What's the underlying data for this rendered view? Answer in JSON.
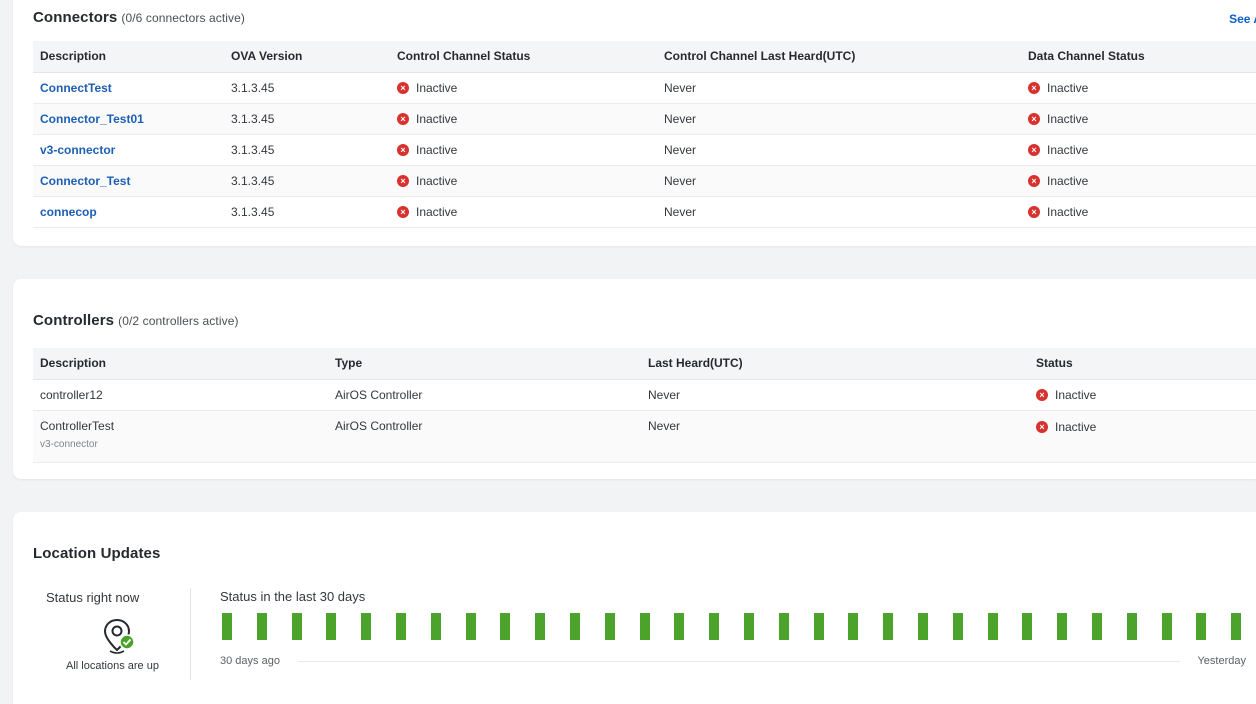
{
  "connectors": {
    "title": "Connectors",
    "subtitle": "(0/6 connectors active)",
    "see_all": "See A",
    "headers": [
      "Description",
      "OVA Version",
      "Control Channel Status",
      "Control Channel Last Heard(UTC)",
      "Data Channel Status"
    ],
    "rows": [
      {
        "description": "ConnectTest",
        "ova": "3.1.3.45",
        "control_status": "Inactive",
        "last_heard": "Never",
        "data_status": "Inactive"
      },
      {
        "description": "Connector_Test01",
        "ova": "3.1.3.45",
        "control_status": "Inactive",
        "last_heard": "Never",
        "data_status": "Inactive"
      },
      {
        "description": "v3-connector",
        "ova": "3.1.3.45",
        "control_status": "Inactive",
        "last_heard": "Never",
        "data_status": "Inactive"
      },
      {
        "description": "Connector_Test",
        "ova": "3.1.3.45",
        "control_status": "Inactive",
        "last_heard": "Never",
        "data_status": "Inactive"
      },
      {
        "description": "connecop",
        "ova": "3.1.3.45",
        "control_status": "Inactive",
        "last_heard": "Never",
        "data_status": "Inactive"
      }
    ]
  },
  "controllers": {
    "title": "Controllers",
    "subtitle": "(0/2 controllers active)",
    "headers": [
      "Description",
      "Type",
      "Last Heard(UTC)",
      "Status"
    ],
    "rows": [
      {
        "description": "controller12",
        "secondary": "",
        "type": "AirOS Controller",
        "last_heard": "Never",
        "status": "Inactive"
      },
      {
        "description": "ControllerTest",
        "secondary": "v3-connector",
        "type": "AirOS Controller",
        "last_heard": "Never",
        "status": "Inactive"
      }
    ]
  },
  "location": {
    "title": "Location Updates",
    "status_now_label": "Status right now",
    "status_now_text": "All locations are up",
    "history_label": "Status in the last 30 days",
    "axis_start": "30 days ago",
    "axis_end": "Yesterday",
    "days_up": 30
  },
  "colors": {
    "link": "#1d5fb5",
    "inactive": "#d7322e",
    "up": "#4ca32b"
  },
  "icons": {
    "inactive": "x-circle-icon",
    "location": "location-pin-check-icon"
  }
}
